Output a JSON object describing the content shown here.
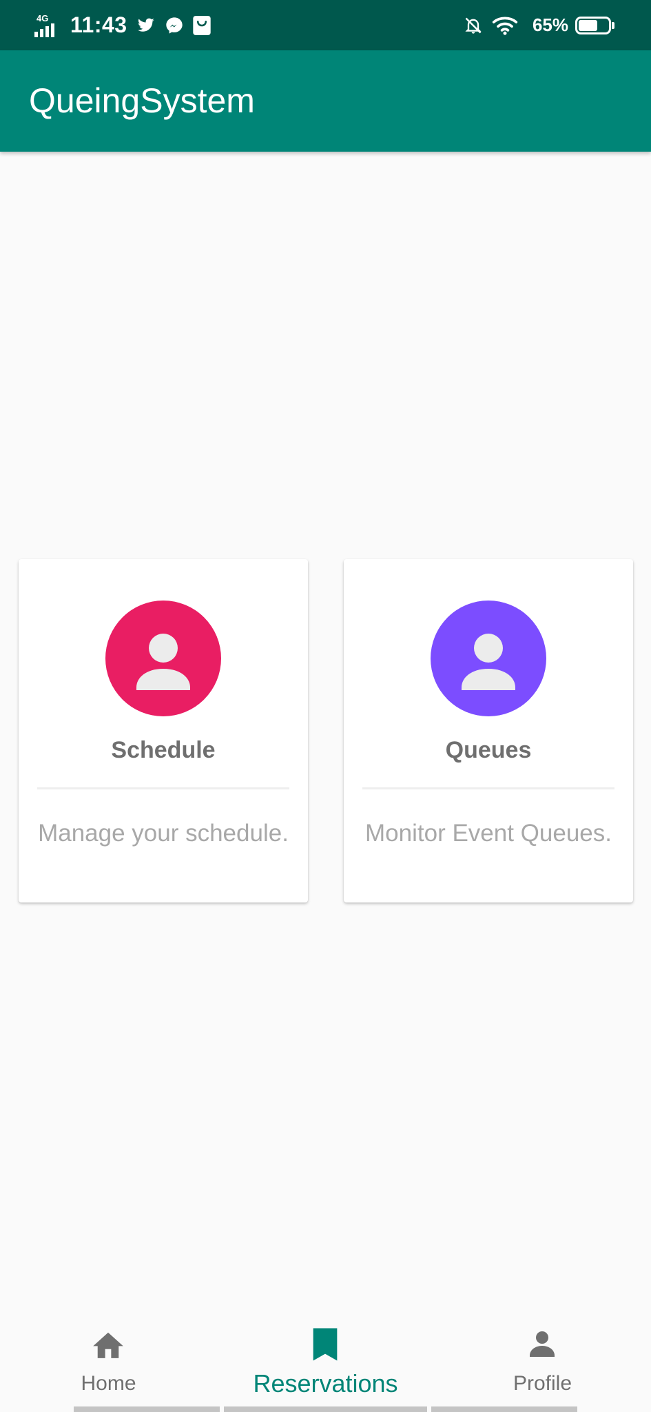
{
  "status_bar": {
    "network_type": "4G",
    "time": "11:43",
    "notification_icons": [
      "twitter-icon",
      "messenger-icon",
      "shopping-bag-icon"
    ],
    "system_icons": [
      "notifications-off-icon",
      "wifi-icon"
    ],
    "battery_percent_text": "65%",
    "battery_level": 0.65
  },
  "app_bar": {
    "title": "QueingSystem",
    "color": "#008577"
  },
  "cards": [
    {
      "title": "Schedule",
      "description": "Manage your schedule.",
      "icon": "person-icon",
      "avatar_color": "#e91e63"
    },
    {
      "title": "Queues",
      "description": "Monitor Event Queues.",
      "icon": "person-icon",
      "avatar_color": "#7c4dff"
    }
  ],
  "bottom_nav": {
    "items": [
      {
        "label": "Home",
        "icon": "home-icon",
        "selected": false
      },
      {
        "label": "Reservations",
        "icon": "bookmark-icon",
        "selected": true
      },
      {
        "label": "Profile",
        "icon": "person-icon",
        "selected": false
      }
    ],
    "active_color": "#008577",
    "inactive_color": "#6f6f6f"
  }
}
